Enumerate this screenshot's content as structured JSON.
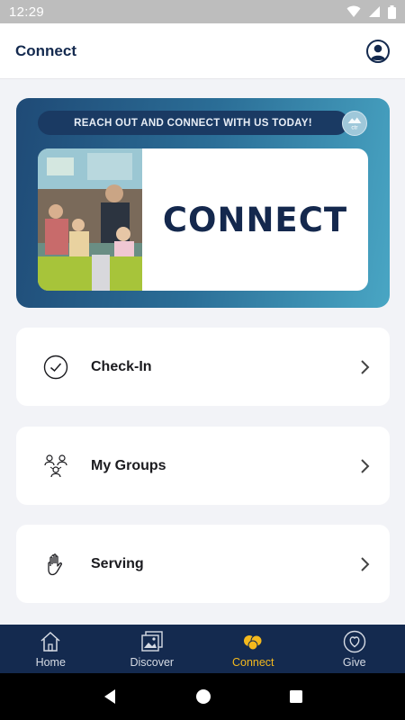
{
  "status_bar": {
    "time": "12:29"
  },
  "header": {
    "title": "Connect"
  },
  "banner": {
    "tagline": "REACH OUT AND CONNECT WITH US TODAY!",
    "logo_text": "ctr",
    "headline": "CONNECT"
  },
  "menu": [
    {
      "label": "Check-In",
      "icon": "check-circle-icon"
    },
    {
      "label": "My Groups",
      "icon": "group-icon"
    },
    {
      "label": "Serving",
      "icon": "hand-icon"
    }
  ],
  "bottom_nav": {
    "items": [
      {
        "label": "Home",
        "icon": "home-icon",
        "active": false
      },
      {
        "label": "Discover",
        "icon": "gallery-icon",
        "active": false
      },
      {
        "label": "Connect",
        "icon": "connect-icon",
        "active": true
      },
      {
        "label": "Give",
        "icon": "heart-icon",
        "active": false
      }
    ]
  },
  "colors": {
    "primary": "#142a4f",
    "accent": "#f4b91d",
    "background": "#f2f3f7"
  }
}
